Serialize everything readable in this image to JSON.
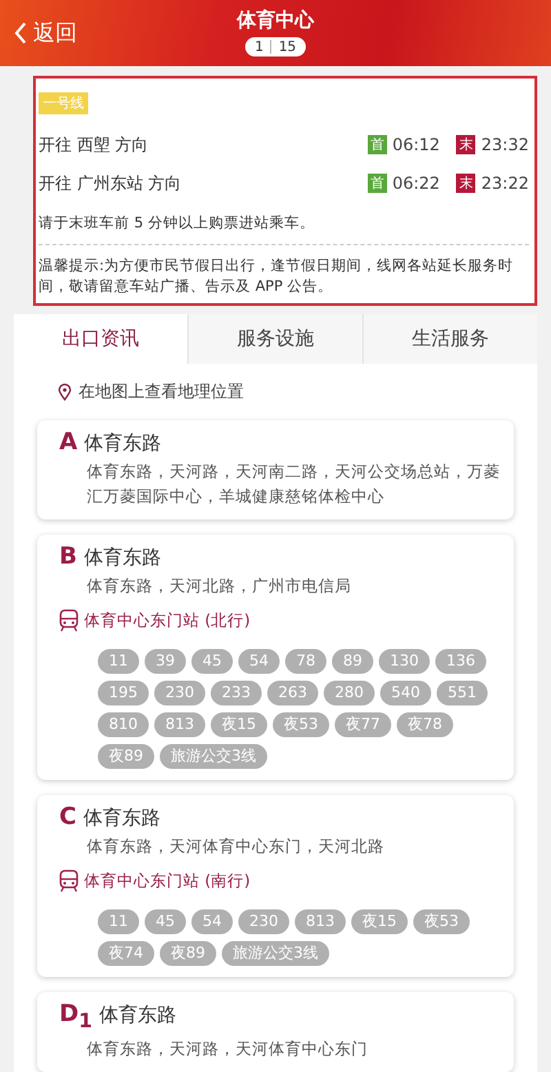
{
  "header": {
    "back_label": "返回",
    "title": "体育中心",
    "page_current": "1",
    "page_total": "15"
  },
  "line_info": {
    "line_name": "一号线",
    "directions": [
      {
        "label": "开往 西塱 方向",
        "first_badge": "首",
        "first_time": "06:12",
        "last_badge": "末",
        "last_time": "23:32"
      },
      {
        "label": "开往 广州东站 方向",
        "first_badge": "首",
        "first_time": "06:22",
        "last_badge": "末",
        "last_time": "23:22"
      }
    ],
    "notice": "请于末班车前 5 分钟以上购票进站乘车。",
    "tip": "温馨提示:为方便市民节假日出行，逢节假日期间，线网各站延长服务时间，敬请留意车站广播、告示及 APP 公告。"
  },
  "tabs": [
    {
      "label": "出口资讯",
      "selected": true
    },
    {
      "label": "服务设施",
      "selected": false
    },
    {
      "label": "生活服务",
      "selected": false
    }
  ],
  "location_link": "在地图上查看地理位置",
  "exits": [
    {
      "letter": "A",
      "title": "体育东路",
      "address": "体育东路，天河路，天河南二路，天河公交场总站，万菱汇万菱国际中心，羊城健康慈铭体检中心"
    },
    {
      "letter": "B",
      "title": "体育东路",
      "address": "体育东路，天河北路，广州市电信局",
      "station": "体育中心东门站 (北行)",
      "bus_routes": [
        "11",
        "39",
        "45",
        "54",
        "78",
        "89",
        "130",
        "136",
        "195",
        "230",
        "233",
        "263",
        "280",
        "540",
        "551",
        "810",
        "813",
        "夜15",
        "夜53",
        "夜77",
        "夜78",
        "夜89",
        "旅游公交3线"
      ]
    },
    {
      "letter": "C",
      "title": "体育东路",
      "address": "体育东路，天河体育中心东门，天河北路",
      "station": "体育中心东门站 (南行)",
      "bus_routes": [
        "11",
        "45",
        "54",
        "230",
        "813",
        "夜15",
        "夜53",
        "夜74",
        "夜89",
        "旅游公交3线"
      ]
    },
    {
      "letter": "D$_{1}$",
      "title": "体育东路",
      "address": "体育东路，天河路，天河体育中心东门"
    }
  ]
}
